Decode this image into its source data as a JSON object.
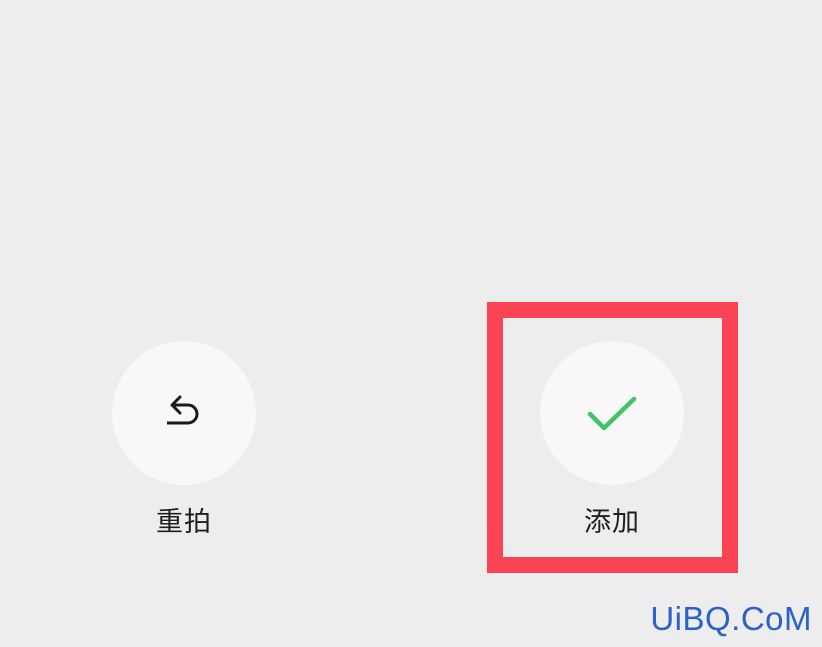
{
  "actions": {
    "retake": {
      "label": "重拍",
      "icon": "undo-arrow-icon"
    },
    "add": {
      "label": "添加",
      "icon": "checkmark-icon",
      "icon_color": "#45c16a"
    }
  },
  "annotation": {
    "highlight_color": "#fb4453"
  },
  "watermark": {
    "text": "UiBQ.CoM",
    "color": "#2a62c9"
  }
}
